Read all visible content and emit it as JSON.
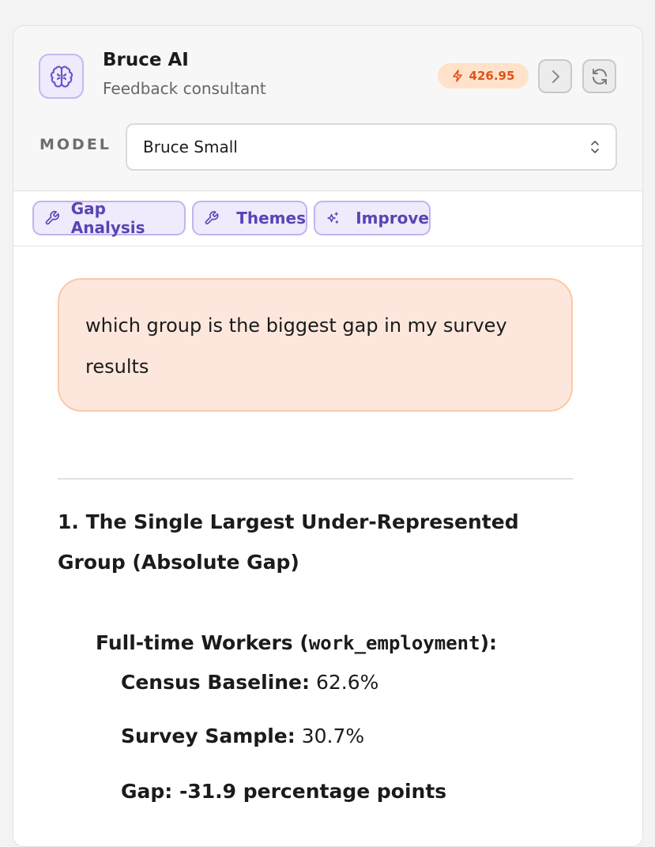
{
  "header": {
    "title": "Bruce AI",
    "subtitle": "Feedback consultant",
    "credits": "426.95",
    "model_label": "MODEL",
    "model_value": "Bruce Small"
  },
  "toolbar": {
    "chips": [
      {
        "label": "Gap Analysis",
        "icon": "wrench-icon"
      },
      {
        "label": "Themes",
        "icon": "wrench-icon"
      },
      {
        "label": "Improve",
        "icon": "sparkles-icon"
      }
    ]
  },
  "chat": {
    "user_message": "which group is the biggest gap in my survey results",
    "response": {
      "heading": "1. The Single Largest Under-Represented Group (Absolute Gap)",
      "group_name": "Full-time Workers (",
      "group_code": "work_employment",
      "group_close": "):",
      "baseline_label": "Census Baseline:",
      "baseline_value": "62.6%",
      "sample_label": "Survey Sample:",
      "sample_value": "30.7%",
      "gap_text": "Gap: -31.9 percentage points"
    }
  },
  "colors": {
    "accent": "#5b43b3",
    "credits": "#e0521c",
    "bubble_bg": "#fde7dc"
  }
}
